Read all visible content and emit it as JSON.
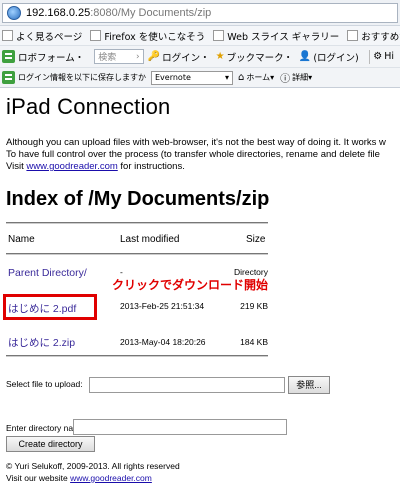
{
  "browser": {
    "url_host": "192.168.0.25",
    "url_path": ":8080/My Documents/zip"
  },
  "bookmarks": [
    {
      "icon": "page-icon",
      "label": "よく見るページ"
    },
    {
      "icon": "page-icon",
      "label": "Firefox を使いこなそう"
    },
    {
      "icon": "page-icon",
      "label": "Web スライス ギャラリー"
    },
    {
      "icon": "page-icon",
      "label": "おすすめサイト"
    }
  ],
  "toolbar1": {
    "robo_label": "ロボフォーム・",
    "search_placeholder": "検索",
    "login_label": "ログイン・",
    "bookmark_label": "ブックマーク・",
    "login2_label": "(ログイン)",
    "hi_label": "Hi"
  },
  "toolbar2": {
    "save_label": "ログイン情報を以下に保存しますか",
    "select_value": "Evernote",
    "home_label": "ホーム",
    "detail_label": "詳細"
  },
  "page": {
    "title": "iPad Connection",
    "intro_line1": "Although you can upload files with web-browser, it's not the best way of doing it. It works w",
    "intro_line2": "To have full control over the process (to transfer whole directories, rename and delete file",
    "intro_line3_prefix": "Visit ",
    "intro_link": "www.goodreader.com",
    "intro_line3_suffix": " for instructions.",
    "index_heading": "Index of /My Documents/zip",
    "columns": {
      "name": "Name",
      "modified": "Last modified",
      "size": "Size"
    },
    "rows": [
      {
        "name": "Parent Directory/",
        "modified": "-",
        "size": "Directory"
      },
      {
        "name": "はじめに 2.pdf",
        "modified": "2013-Feb-25 21:51:34",
        "size": "219 KB"
      },
      {
        "name": "はじめに 2.zip",
        "modified": "2013-May-04 18:20:26",
        "size": "184 KB"
      }
    ],
    "annotation": "クリックでダウンロード開始",
    "upload_label": "Select file to upload:",
    "browse_label": "参照...",
    "dir_label": "Enter directory name:",
    "create_dir_label": "Create directory",
    "footer_copyright": "© Yuri Selukoff, 2009-2013. All rights reserved",
    "footer_visit": "Visit our website ",
    "footer_link": "www.goodreader.com"
  },
  "colors": {
    "annotation": "#e00000",
    "link": "#1a0dab",
    "row_link": "#3a2a9a"
  }
}
